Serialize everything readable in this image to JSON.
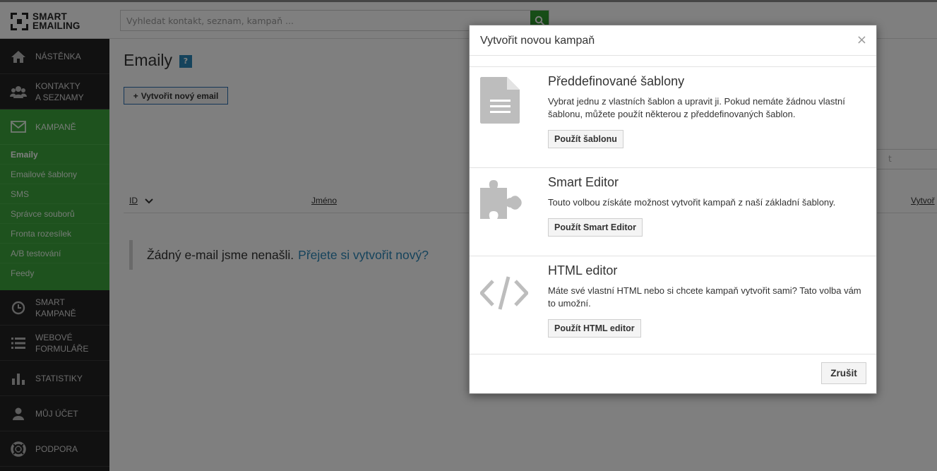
{
  "app": {
    "logo_line1": "SMART",
    "logo_line2": "EMAILING"
  },
  "search": {
    "placeholder": "Vyhledat kontakt, seznam, kampaň ..."
  },
  "sidebar": {
    "items": [
      {
        "label_line1": "NÁSTĚNKA",
        "label_line2": "",
        "icon": "home-icon"
      },
      {
        "label_line1": "KONTAKTY",
        "label_line2": "A SEZNAMY",
        "icon": "users-icon"
      },
      {
        "label_line1": "KAMPANĚ",
        "label_line2": "",
        "icon": "envelope-icon"
      },
      {
        "label_line1": "SMART",
        "label_line2": "KAMPANĚ",
        "icon": "clock-icon"
      },
      {
        "label_line1": "WEBOVÉ",
        "label_line2": "FORMULÁŘE",
        "icon": "list-icon"
      },
      {
        "label_line1": "STATISTIKY",
        "label_line2": "",
        "icon": "bar-chart-icon"
      },
      {
        "label_line1": "MŮJ ÚČET",
        "label_line2": "",
        "icon": "user-icon"
      },
      {
        "label_line1": "PODPORA",
        "label_line2": "",
        "icon": "lifebuoy-icon"
      }
    ],
    "submenu": [
      "Emaily",
      "Emailové šablony",
      "SMS",
      "Správce souborů",
      "Fronta rozesílek",
      "A/B testování",
      "Feedy"
    ]
  },
  "main": {
    "title": "Emaily",
    "help": "?",
    "new_button": "Vytvořit nový email",
    "filter_fragment": "t",
    "columns": {
      "id": "ID",
      "name": "Jméno",
      "created": "Vytvoř"
    },
    "empty_text": "Žádný e-mail jsme nenašli.",
    "empty_link": "Přejete si vytvořit nový?"
  },
  "modal": {
    "title": "Vytvořit novou kampaň",
    "close": "×",
    "options": [
      {
        "title": "Předdefinované šablony",
        "desc": "Vybrat jednu z vlastních šablon a upravit ji. Pokud nemáte žádnou vlastní šablonu, můžete použít některou z předdefinovaných šablon.",
        "button": "Použít šablonu",
        "icon": "document-icon"
      },
      {
        "title": "Smart Editor",
        "desc": "Touto volbou získáte možnost vytvořit kampaň z naší základní šablony.",
        "button": "Použít Smart Editor",
        "icon": "puzzle-icon"
      },
      {
        "title": "HTML editor",
        "desc": "Máte své vlastní HTML nebo si chcete kampaň vytvořit sami? Tato volba vám to umožní.",
        "button": "Použít HTML editor",
        "icon": "code-icon"
      }
    ],
    "cancel": "Zrušit"
  }
}
